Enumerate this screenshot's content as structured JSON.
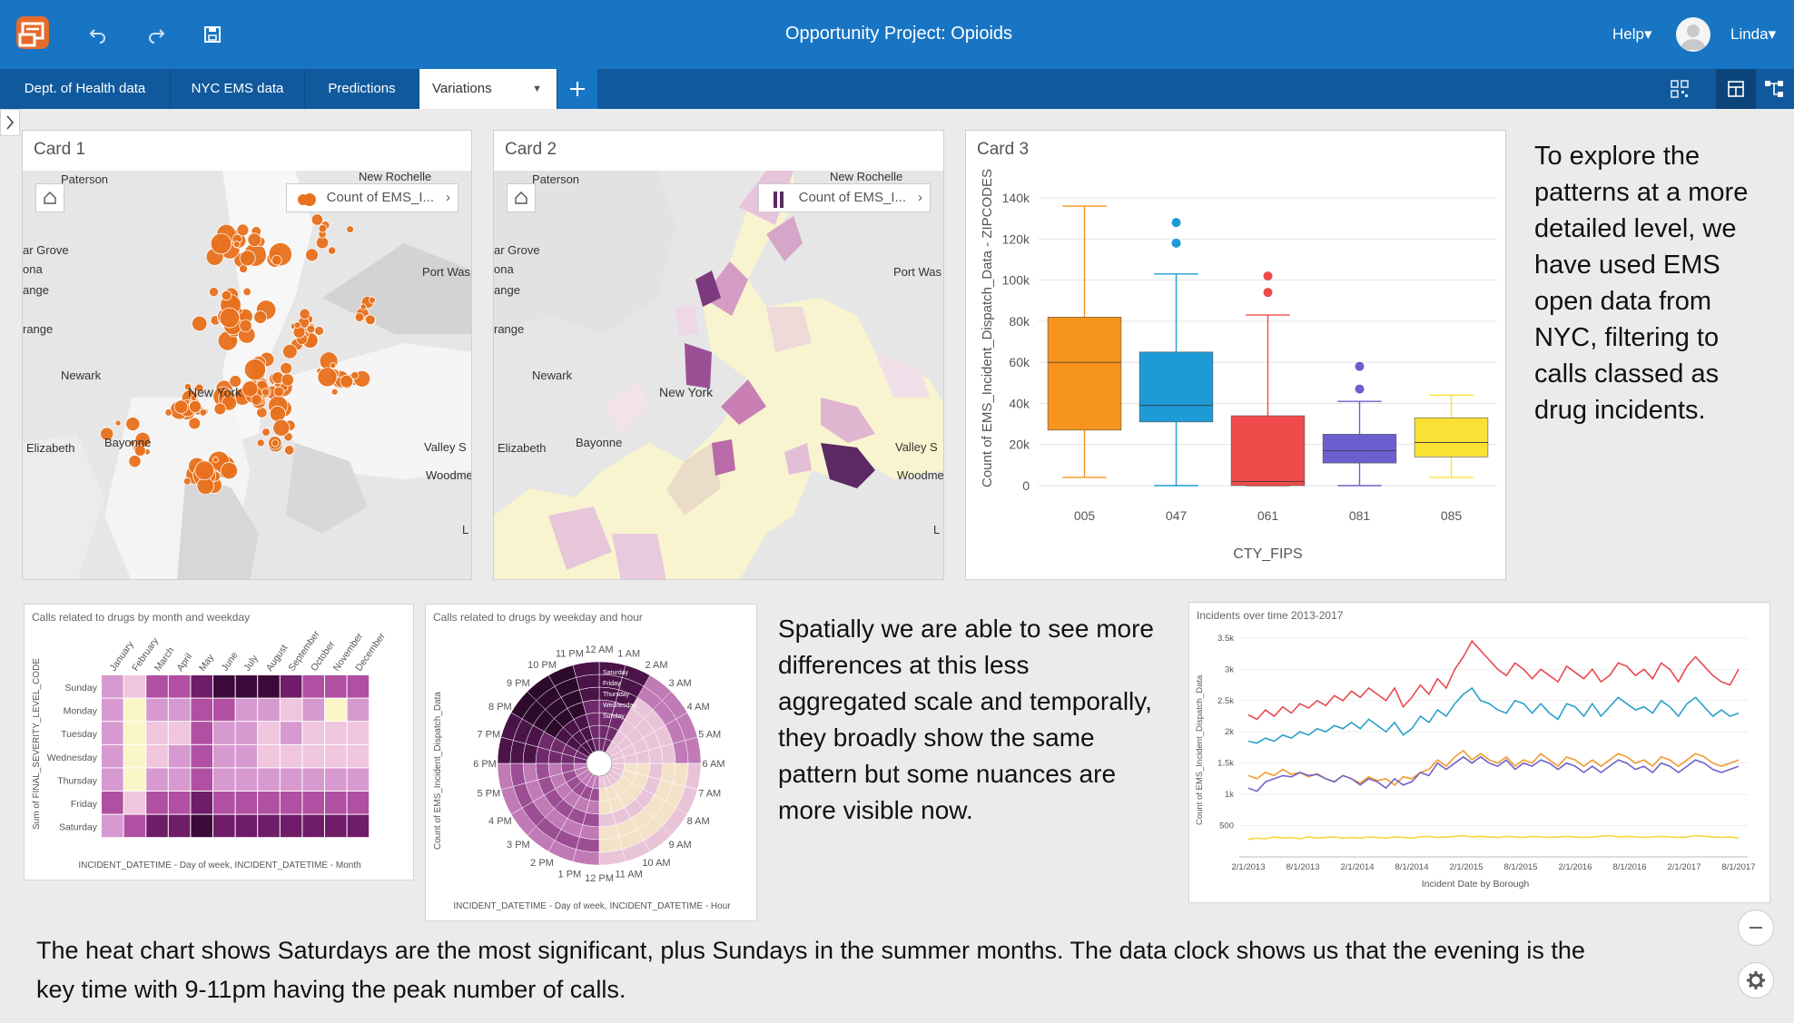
{
  "app": {
    "title": "Opportunity Project: Opioids",
    "help_label": "Help▾",
    "user_label": "Linda▾"
  },
  "tabs": [
    {
      "label": "Dept. of Health data"
    },
    {
      "label": "NYC EMS data"
    },
    {
      "label": "Predictions"
    },
    {
      "label": "Variations"
    }
  ],
  "cards": {
    "card1": {
      "title": "Card 1",
      "legend": "Count of EMS_I..."
    },
    "card2": {
      "title": "Card 2",
      "legend": "Count of EMS_I..."
    },
    "card3": {
      "title": "Card 3"
    }
  },
  "map_labels": [
    "Paterson",
    "New Rochelle",
    "ar Grove",
    "ona",
    "ange",
    "range",
    "Port Was",
    "Newark",
    "New York",
    "Elizabeth",
    "Bayonne",
    "Valley S",
    "Woodme",
    "L"
  ],
  "colors": {
    "topbar": "#1875c4",
    "tabbar": "#10599c",
    "dots": "#e8711d",
    "choropleth_dark": "#5b2a63",
    "series_red": "#e84a4f",
    "series_blue": "#2aa1c9",
    "series_orange": "#f29a2e",
    "series_purple": "#6f64c8",
    "series_yellow": "#f4d63b"
  },
  "explore_text": "To explore the patterns at a more detailed level, we have used EMS open data from NYC, filtering to calls classed as drug incidents.",
  "spatial_text": "Spatially we are able to see more differences at this less aggregated scale and temporally, they broadly show the same pattern but some nuances are more visible now.",
  "bottom_text": "The heat chart shows Saturdays are the most significant, plus Sundays in the summer months.  The data clock shows us that the evening is the key time with 9-11pm having the peak number of calls.",
  "chart_data": [
    {
      "type": "box",
      "xlabel": "CTY_FIPS",
      "ylabel": "Count of EMS_Incident_Dispatch_Data - ZIPCODES",
      "ylim": [
        0,
        140000
      ],
      "yticks": [
        "0",
        "20k",
        "40k",
        "60k",
        "80k",
        "100k",
        "120k",
        "140k"
      ],
      "categories": [
        "005",
        "047",
        "061",
        "081",
        "085"
      ],
      "boxes": [
        {
          "min": 4000,
          "q1": 27000,
          "median": 60000,
          "q3": 82000,
          "max": 136000,
          "outliers": [],
          "color": "#f7941d"
        },
        {
          "min": 0,
          "q1": 31000,
          "median": 39000,
          "q3": 65000,
          "max": 103000,
          "outliers": [
            118000,
            128000
          ],
          "color": "#1e9bd7"
        },
        {
          "min": 0,
          "q1": 0,
          "median": 2000,
          "q3": 34000,
          "max": 83000,
          "outliers": [
            94000,
            102000
          ],
          "color": "#ef4b4b"
        },
        {
          "min": 0,
          "q1": 11000,
          "median": 17000,
          "q3": 25000,
          "max": 41000,
          "outliers": [
            47000,
            58000
          ],
          "color": "#6b5fcf"
        },
        {
          "min": 4000,
          "q1": 14000,
          "median": 21000,
          "q3": 33000,
          "max": 44000,
          "outliers": [],
          "color": "#fbe135"
        }
      ]
    },
    {
      "type": "heatmap",
      "title": "Calls related to drugs by month and weekday",
      "xlabel": "INCIDENT_DATETIME - Day of week, INCIDENT_DATETIME - Month",
      "ylabel": "Sum of FINAL_SEVERITY_LEVEL_CODE",
      "months": [
        "January",
        "February",
        "March",
        "April",
        "May",
        "June",
        "July",
        "August",
        "September",
        "October",
        "November",
        "December"
      ],
      "weekdays": [
        "Sunday",
        "Monday",
        "Tuesday",
        "Wednesday",
        "Thursday",
        "Friday",
        "Saturday"
      ],
      "values": [
        [
          2,
          1,
          3,
          3,
          4,
          5,
          5,
          5,
          4,
          3,
          3,
          3
        ],
        [
          2,
          0,
          2,
          2,
          3,
          3,
          2,
          2,
          1,
          2,
          0,
          2
        ],
        [
          2,
          0,
          1,
          1,
          3,
          2,
          2,
          1,
          2,
          1,
          1,
          1
        ],
        [
          2,
          0,
          1,
          2,
          3,
          2,
          2,
          1,
          1,
          1,
          1,
          1
        ],
        [
          2,
          0,
          2,
          2,
          3,
          2,
          2,
          2,
          2,
          2,
          2,
          2
        ],
        [
          3,
          1,
          3,
          3,
          4,
          3,
          3,
          3,
          3,
          3,
          3,
          3
        ],
        [
          2,
          3,
          4,
          4,
          5,
          4,
          4,
          4,
          4,
          4,
          4,
          4
        ]
      ]
    },
    {
      "type": "radial_heatmap",
      "title": "Calls related to drugs by weekday and hour",
      "xlabel": "INCIDENT_DATETIME - Day of week, INCIDENT_DATETIME - Hour",
      "ylabel": "Count of EMS_Incident_Dispatch_Data",
      "hours": [
        "12 AM",
        "1 AM",
        "2 AM",
        "3 AM",
        "4 AM",
        "5 AM",
        "6 AM",
        "7 AM",
        "8 AM",
        "9 AM",
        "10 AM",
        "11 AM",
        "12 PM",
        "1 PM",
        "2 PM",
        "3 PM",
        "4 PM",
        "5 PM",
        "6 PM",
        "7 PM",
        "8 PM",
        "9 PM",
        "10 PM",
        "11 PM"
      ],
      "weekday_ring_labels": [
        "Saturday",
        "Friday",
        "Thursday",
        "Wednesday",
        "Sunday"
      ]
    },
    {
      "type": "line",
      "title": "Incidents over time 2013-2017",
      "xlabel": "Incident Date by Borough",
      "ylabel": "Count of EMS_Incident_Dispatch_Data",
      "ylim": [
        0,
        3600
      ],
      "yticks": [
        "500",
        "1k",
        "1.5k",
        "2k",
        "2.5k",
        "3k",
        "3.5k"
      ],
      "xticks": [
        "2/1/2013",
        "8/1/2013",
        "2/1/2014",
        "8/1/2014",
        "2/1/2015",
        "8/1/2015",
        "2/1/2016",
        "8/1/2016",
        "2/1/2017",
        "8/1/2017"
      ],
      "series": [
        {
          "color": "#e84a4f",
          "values": [
            2270,
            2200,
            2350,
            2250,
            2400,
            2300,
            2450,
            2380,
            2500,
            2420,
            2580,
            2500,
            2650,
            2550,
            2700,
            2600,
            2500,
            2700,
            2400,
            2550,
            2750,
            2600,
            2850,
            2700,
            3000,
            3200,
            3450,
            3300,
            3150,
            3000,
            2900,
            3100,
            3000,
            2850,
            3000,
            2900,
            2800,
            3050,
            2950,
            2850,
            3000,
            2800,
            2900,
            3100,
            3050,
            2900,
            3000,
            2850,
            3100,
            3000,
            2800,
            3050,
            3200,
            3050,
            2900,
            2800,
            2750,
            3000
          ]
        },
        {
          "color": "#2aa1c9",
          "values": [
            1850,
            1820,
            1900,
            1850,
            1950,
            1900,
            2000,
            1950,
            2050,
            2000,
            2100,
            2050,
            2150,
            2050,
            2200,
            2100,
            2000,
            2150,
            1950,
            2050,
            2250,
            2150,
            2350,
            2250,
            2450,
            2600,
            2700,
            2500,
            2450,
            2350,
            2300,
            2500,
            2450,
            2300,
            2450,
            2300,
            2200,
            2450,
            2400,
            2250,
            2450,
            2250,
            2400,
            2550,
            2450,
            2350,
            2400,
            2300,
            2500,
            2400,
            2250,
            2450,
            2550,
            2400,
            2250,
            2350,
            2250,
            2300
          ]
        },
        {
          "color": "#f29a2e",
          "values": [
            1300,
            1250,
            1350,
            1300,
            1400,
            1320,
            1350,
            1280,
            1330,
            1250,
            1200,
            1300,
            1250,
            1180,
            1280,
            1220,
            1250,
            1150,
            1280,
            1250,
            1350,
            1400,
            1550,
            1450,
            1600,
            1700,
            1550,
            1650,
            1550,
            1500,
            1600,
            1450,
            1550,
            1500,
            1650,
            1550,
            1450,
            1600,
            1550,
            1450,
            1550,
            1450,
            1550,
            1650,
            1600,
            1500,
            1550,
            1450,
            1600,
            1550,
            1450,
            1550,
            1650,
            1600,
            1500,
            1450,
            1500,
            1550
          ]
        },
        {
          "color": "#6f64c8",
          "values": [
            1100,
            1050,
            1200,
            1250,
            1300,
            1280,
            1350,
            1300,
            1320,
            1250,
            1200,
            1300,
            1250,
            1150,
            1250,
            1200,
            1100,
            1250,
            1150,
            1200,
            1350,
            1300,
            1500,
            1400,
            1500,
            1600,
            1500,
            1600,
            1500,
            1450,
            1550,
            1400,
            1500,
            1450,
            1550,
            1500,
            1400,
            1500,
            1450,
            1350,
            1450,
            1350,
            1450,
            1550,
            1500,
            1400,
            1450,
            1350,
            1500,
            1450,
            1350,
            1450,
            1550,
            1500,
            1400,
            1350,
            1400,
            1450
          ]
        },
        {
          "color": "#f4d63b",
          "values": [
            280,
            300,
            290,
            320,
            300,
            310,
            290,
            320,
            300,
            310,
            320,
            300,
            310,
            300,
            320,
            310,
            300,
            320,
            310,
            300,
            320,
            330,
            310,
            320,
            330,
            340,
            320,
            330,
            320,
            310,
            330,
            320,
            310,
            330,
            320,
            310,
            320,
            330,
            320,
            310,
            320,
            330,
            340,
            320,
            330,
            320,
            310,
            320,
            330,
            320,
            310,
            320,
            340,
            330,
            320,
            310,
            320,
            300
          ]
        }
      ]
    }
  ]
}
